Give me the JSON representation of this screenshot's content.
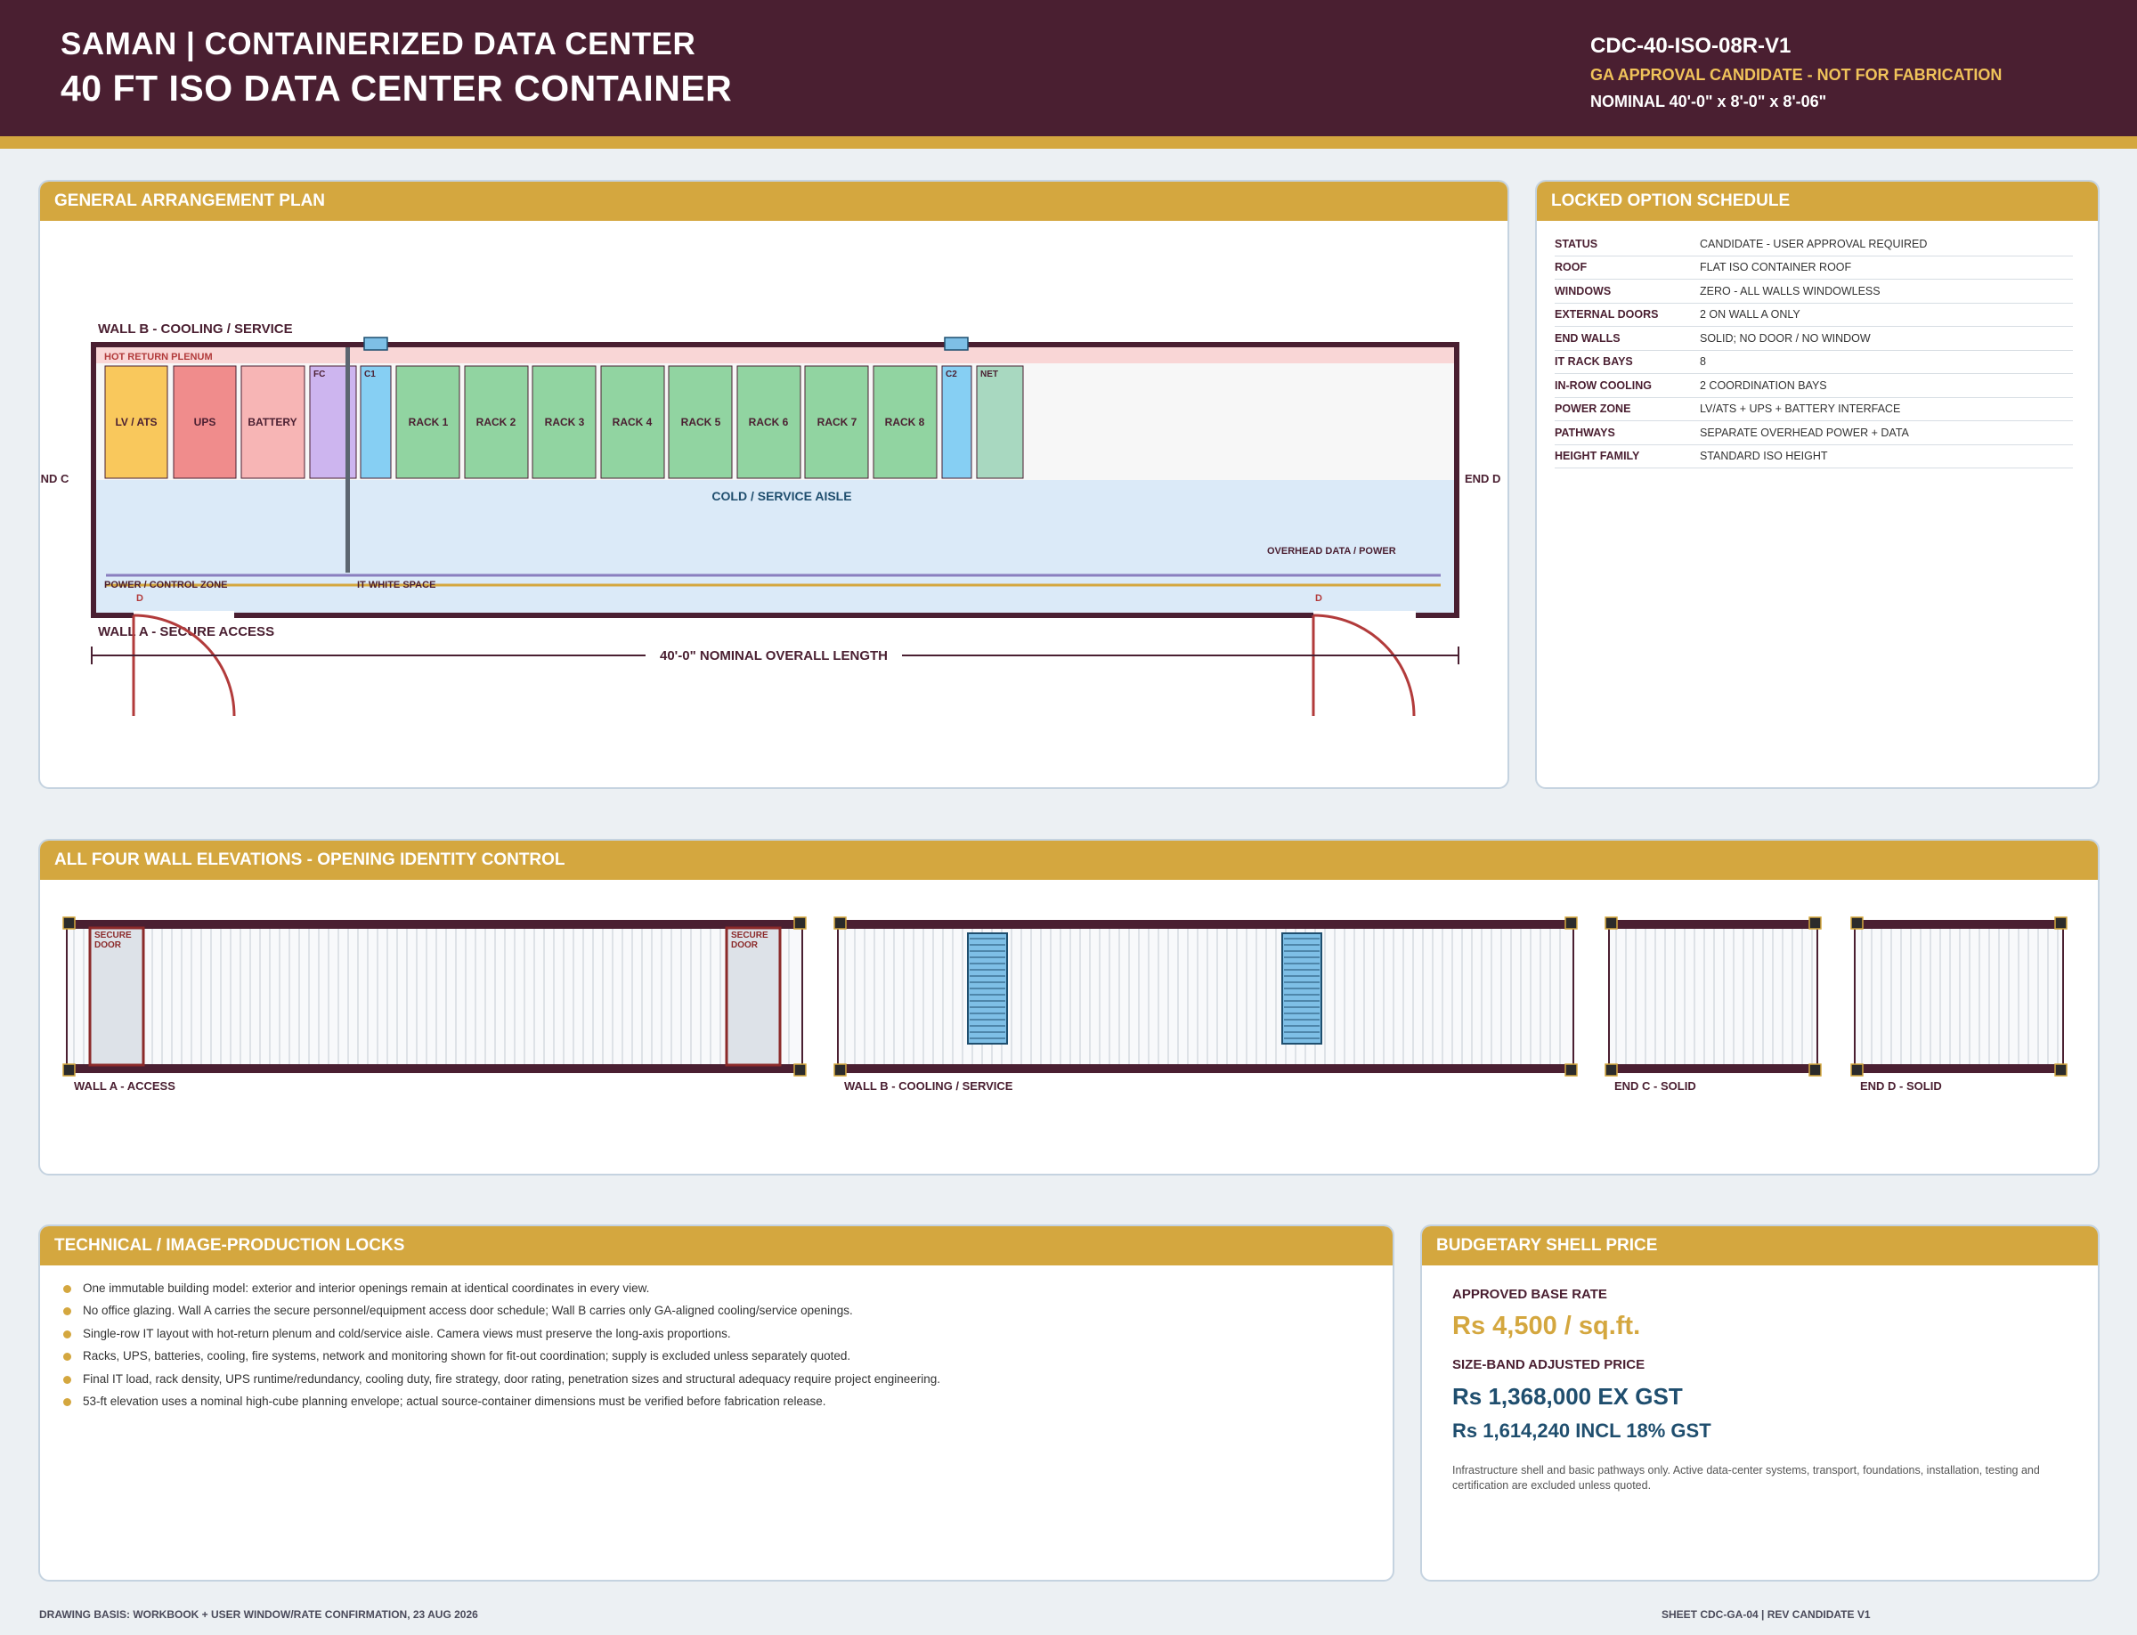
{
  "header": {
    "line1": "SAMAN  |  CONTAINERIZED DATA CENTER",
    "line2": "40 FT ISO DATA CENTER CONTAINER",
    "code": "CDC-40-ISO-08R-V1",
    "status": "GA APPROVAL CANDIDATE - NOT FOR FABRICATION",
    "nominal": "NOMINAL 40'-0\" x 8'-0\" x 8'-06\""
  },
  "ga_plan": {
    "title": "GENERAL ARRANGEMENT PLAN",
    "wall_b": "WALL B - COOLING / SERVICE",
    "wall_a": "WALL A - SECURE ACCESS",
    "end_c": "END C",
    "end_d": "END D",
    "hot_plenum": "HOT RETURN PLENUM",
    "cold_aisle": "COLD / SERVICE AISLE",
    "overhead": "OVERHEAD DATA / POWER",
    "power_zone": "POWER / CONTROL ZONE",
    "it_space": "IT WHITE SPACE",
    "door_tag": "D",
    "dimension": "40'-0\" NOMINAL OVERALL LENGTH",
    "blocks": {
      "lv": "LV / ATS",
      "ups": "UPS",
      "battery": "BATTERY",
      "fc": "FC",
      "c1": "C1",
      "r1": "RACK 1",
      "r2": "RACK 2",
      "r3": "RACK 3",
      "r4": "RACK 4",
      "r5": "RACK 5",
      "r6": "RACK 6",
      "r7": "RACK 7",
      "r8": "RACK 8",
      "c2": "C2",
      "net": "NET"
    }
  },
  "schedule": {
    "title": "LOCKED OPTION SCHEDULE",
    "rows": [
      {
        "k": "STATUS",
        "v": "CANDIDATE - USER APPROVAL REQUIRED"
      },
      {
        "k": "ROOF",
        "v": "FLAT ISO CONTAINER ROOF"
      },
      {
        "k": "WINDOWS",
        "v": "ZERO - ALL WALLS WINDOWLESS"
      },
      {
        "k": "EXTERNAL DOORS",
        "v": "2 ON WALL A ONLY"
      },
      {
        "k": "END WALLS",
        "v": "SOLID; NO DOOR / NO WINDOW"
      },
      {
        "k": "IT RACK BAYS",
        "v": "8"
      },
      {
        "k": "IN-ROW COOLING",
        "v": "2 COORDINATION BAYS"
      },
      {
        "k": "POWER ZONE",
        "v": "LV/ATS + UPS + BATTERY INTERFACE"
      },
      {
        "k": "PATHWAYS",
        "v": "SEPARATE OVERHEAD POWER + DATA"
      },
      {
        "k": "HEIGHT FAMILY",
        "v": "STANDARD ISO HEIGHT"
      }
    ]
  },
  "elevations": {
    "title": "ALL FOUR WALL ELEVATIONS - OPENING IDENTITY CONTROL",
    "wall_a": "WALL A - ACCESS",
    "wall_b": "WALL B - COOLING / SERVICE",
    "end_c": "END C - SOLID",
    "end_d": "END D - SOLID",
    "door_l1": "SECURE",
    "door_l2": "DOOR"
  },
  "locks": {
    "title": "TECHNICAL / IMAGE-PRODUCTION LOCKS",
    "items": [
      "One immutable building model: exterior and interior openings remain at identical coordinates in every view.",
      "No office glazing. Wall A carries the secure personnel/equipment access door schedule; Wall B carries only GA-aligned cooling/service openings.",
      "Single-row IT layout with hot-return plenum and cold/service aisle. Camera views must preserve the long-axis proportions.",
      "Racks, UPS, batteries, cooling, fire systems, network and monitoring shown for fit-out coordination; supply is excluded unless separately quoted.",
      "Final IT load, rack density, UPS runtime/redundancy, cooling duty, fire strategy, door rating, penetration sizes and structural adequacy require project engineering.",
      "53-ft elevation uses a nominal high-cube planning envelope; actual source-container dimensions must be verified before fabrication release."
    ]
  },
  "price": {
    "title": "BUDGETARY SHELL PRICE",
    "base_label": "APPROVED BASE RATE",
    "base_value": "Rs 4,500 / sq.ft.",
    "adj_label": "SIZE-BAND ADJUSTED PRICE",
    "ex_gst": "Rs 1,368,000  EX GST",
    "incl_gst": "Rs 1,614,240  INCL 18% GST",
    "note": "Infrastructure shell and basic pathways only. Active data-center systems, transport, foundations, installation, testing and certification are excluded unless quoted."
  },
  "footer": {
    "left": "DRAWING BASIS: WORKBOOK + USER WINDOW/RATE CONFIRMATION, 23 AUG 2026",
    "right": "SHEET CDC-GA-04  |  REV CANDIDATE V1"
  }
}
